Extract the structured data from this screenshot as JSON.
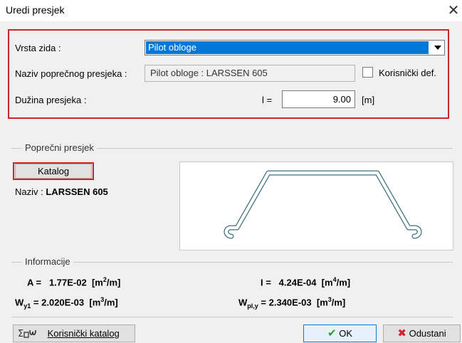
{
  "window": {
    "title": "Uredi presjek",
    "close_glyph": "✕"
  },
  "top": {
    "wall_type_label": "Vrsta zida :",
    "wall_type_value": "Pilot obloge",
    "section_name_label": "Naziv poprečnog presjeka :",
    "section_name_value": "Pilot obloge : LARSSEN 605",
    "user_def_label": "Korisnički def.",
    "user_def_checked": false,
    "length_label": "Dužina presjeka :",
    "length_symbol": "l =",
    "length_value": "9.00",
    "length_unit": "[m]"
  },
  "cross_section": {
    "group_title": "Poprečni presjek",
    "catalog_button": "Katalog",
    "name_label": "Naziv :",
    "name_value": "LARSSEN 605"
  },
  "info": {
    "group_title": "Informacije",
    "A_sym": "A =",
    "A_val": "1.77E-02",
    "A_unit_pre": "[m",
    "A_unit_exp": "2",
    "A_unit_post": "/m]",
    "I_sym": "I =",
    "I_val": "4.24E-04",
    "I_unit_pre": "[m",
    "I_unit_exp": "4",
    "I_unit_post": "/m]",
    "Wy1_sym": "W",
    "Wy1_sub": "y1",
    "Wy1_eq": " = ",
    "Wy1_val": "2.020E-03",
    "Wy1_unit_pre": "[m",
    "Wy1_unit_exp": "3",
    "Wy1_unit_post": "/m]",
    "Wpl_sym": "W",
    "Wpl_sub": "pl,y",
    "Wpl_eq": " = ",
    "Wpl_val": "2.340E-03",
    "Wpl_unit_pre": "[m",
    "Wpl_unit_exp": "3",
    "Wpl_unit_post": "/m]"
  },
  "buttons": {
    "user_catalog": "Korisnički katalog",
    "ok": "OK",
    "cancel": "Odustani"
  },
  "colors": {
    "accent": "#0078d7",
    "highlight_border": "#d2232a",
    "ok_check": "#2e9b2e",
    "cancel_x": "#d2232a",
    "profile_stroke": "#3d6f7d"
  }
}
